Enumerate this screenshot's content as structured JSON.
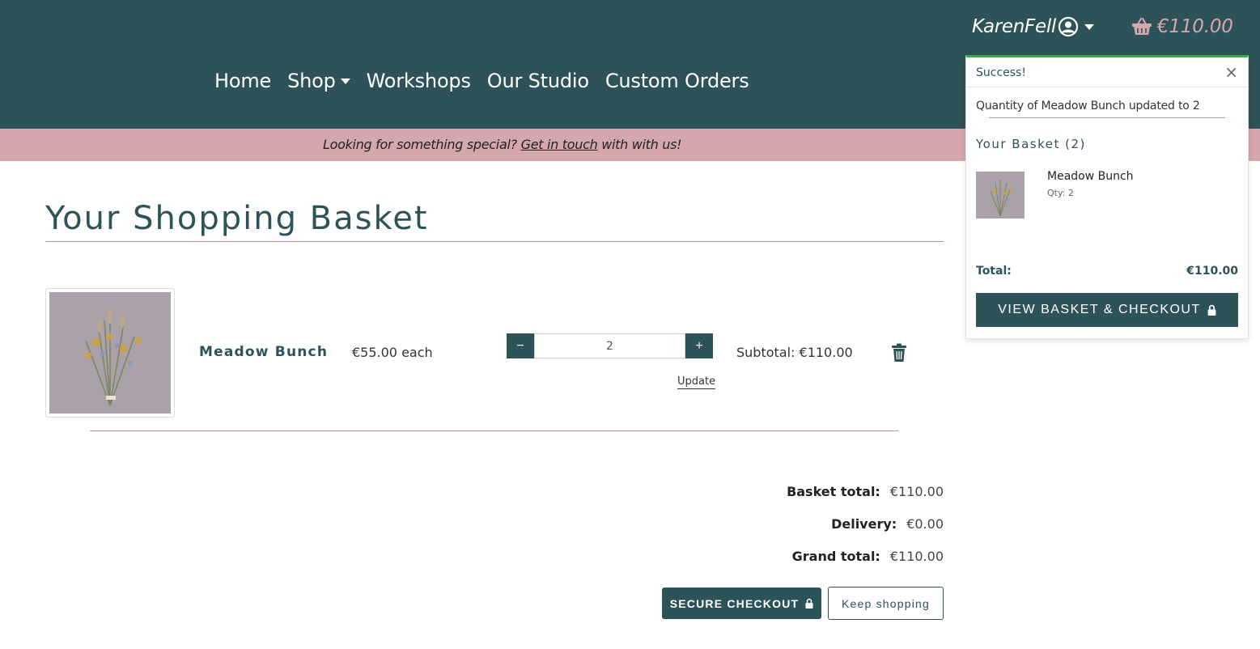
{
  "header": {
    "username": "KarenFell",
    "basket_amount": "€110.00",
    "nav": [
      "Home",
      "Shop",
      "Workshops",
      "Our Studio",
      "Custom Orders"
    ]
  },
  "banner": {
    "before": "Looking for something special?",
    "link": "Get in touch",
    "after": "with with us!"
  },
  "page": {
    "title": "Your Shopping Basket"
  },
  "basket_item": {
    "name": "Meadow Bunch",
    "price": "€55.00 each",
    "qty_minus": "−",
    "qty_plus": "+",
    "quantity": "2",
    "update_label": "Update",
    "subtotal": "Subtotal: €110.00"
  },
  "totals": {
    "basket_label": "Basket total:",
    "basket_value": "€110.00",
    "delivery_label": "Delivery:",
    "delivery_value": "€0.00",
    "grand_label": "Grand total:",
    "grand_value": "€110.00"
  },
  "buttons": {
    "checkout": "SECURE CHECKOUT",
    "keep_shopping": "Keep shopping"
  },
  "toast": {
    "title": "Success!",
    "close": "×",
    "message": "Quantity of Meadow Bunch updated to 2",
    "basket_heading": "Your Basket (2)",
    "item_name": "Meadow Bunch",
    "item_qty": "Qty: 2",
    "total_label": "Total:",
    "total_value": "€110.00",
    "button": "VIEW BASKET & CHECKOUT"
  },
  "colors": {
    "primary": "#2d5358",
    "accent_pink": "#d4a7ac",
    "success": "#3cab4a"
  },
  "icons": [
    "user-circle-icon",
    "basket-icon",
    "trash-icon",
    "lock-icon",
    "close-icon",
    "caret-down-icon"
  ]
}
